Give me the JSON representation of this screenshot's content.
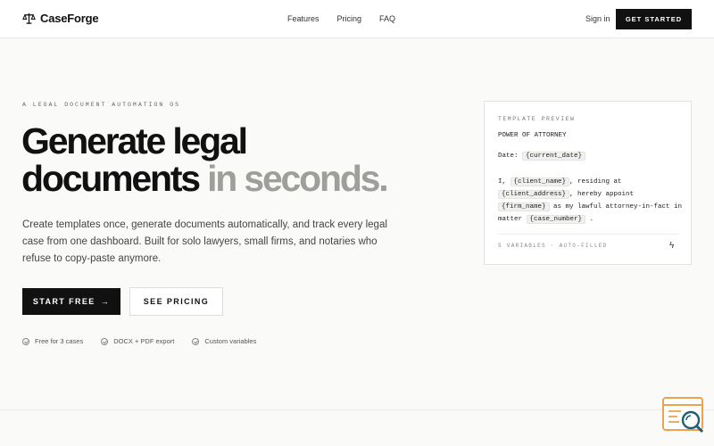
{
  "header": {
    "brand": "CaseForge",
    "nav": [
      "Features",
      "Pricing",
      "FAQ"
    ],
    "signin": "Sign in",
    "cta": "GET STARTED"
  },
  "hero": {
    "eyebrow": "A LEGAL DOCUMENT AUTOMATION OS",
    "headline_line1": "Generate legal",
    "headline_line2_strong": "documents",
    "headline_line2_muted": "in seconds.",
    "description": "Create templates once, generate documents automatically, and track every legal case from one dashboard. Built for solo lawyers, small firms, and notaries who refuse to copy-paste anymore.",
    "primary_cta": "START FREE",
    "secondary_cta": "SEE PRICING",
    "features": [
      "Free for 3 cases",
      "DOCX + PDF export",
      "Custom variables"
    ]
  },
  "preview": {
    "label": "TEMPLATE PREVIEW",
    "doc_title": "POWER OF ATTORNEY",
    "date_label": "Date:",
    "date_var": "{current_date}",
    "t_i": "I,",
    "v_client_name": "{client_name}",
    "t_residing": ", residing at",
    "v_client_address": "{client_address}",
    "t_appoint": ", hereby appoint",
    "v_firm_name": "{firm_name}",
    "t_attorney": "as my lawful attorney-in-fact in",
    "t_matter": "matter",
    "v_case_number": "{case_number}",
    "t_period": ".",
    "footer": "5 VARIABLES · AUTO-FILLED"
  },
  "colors": {
    "accent": "#111111",
    "muted_headline": "#9e9e9a",
    "widget": "#f0a050"
  },
  "icons": [
    "scales-icon",
    "arrow-right-icon",
    "check-circle-icon",
    "bolt-icon",
    "search-widget-icon"
  ]
}
